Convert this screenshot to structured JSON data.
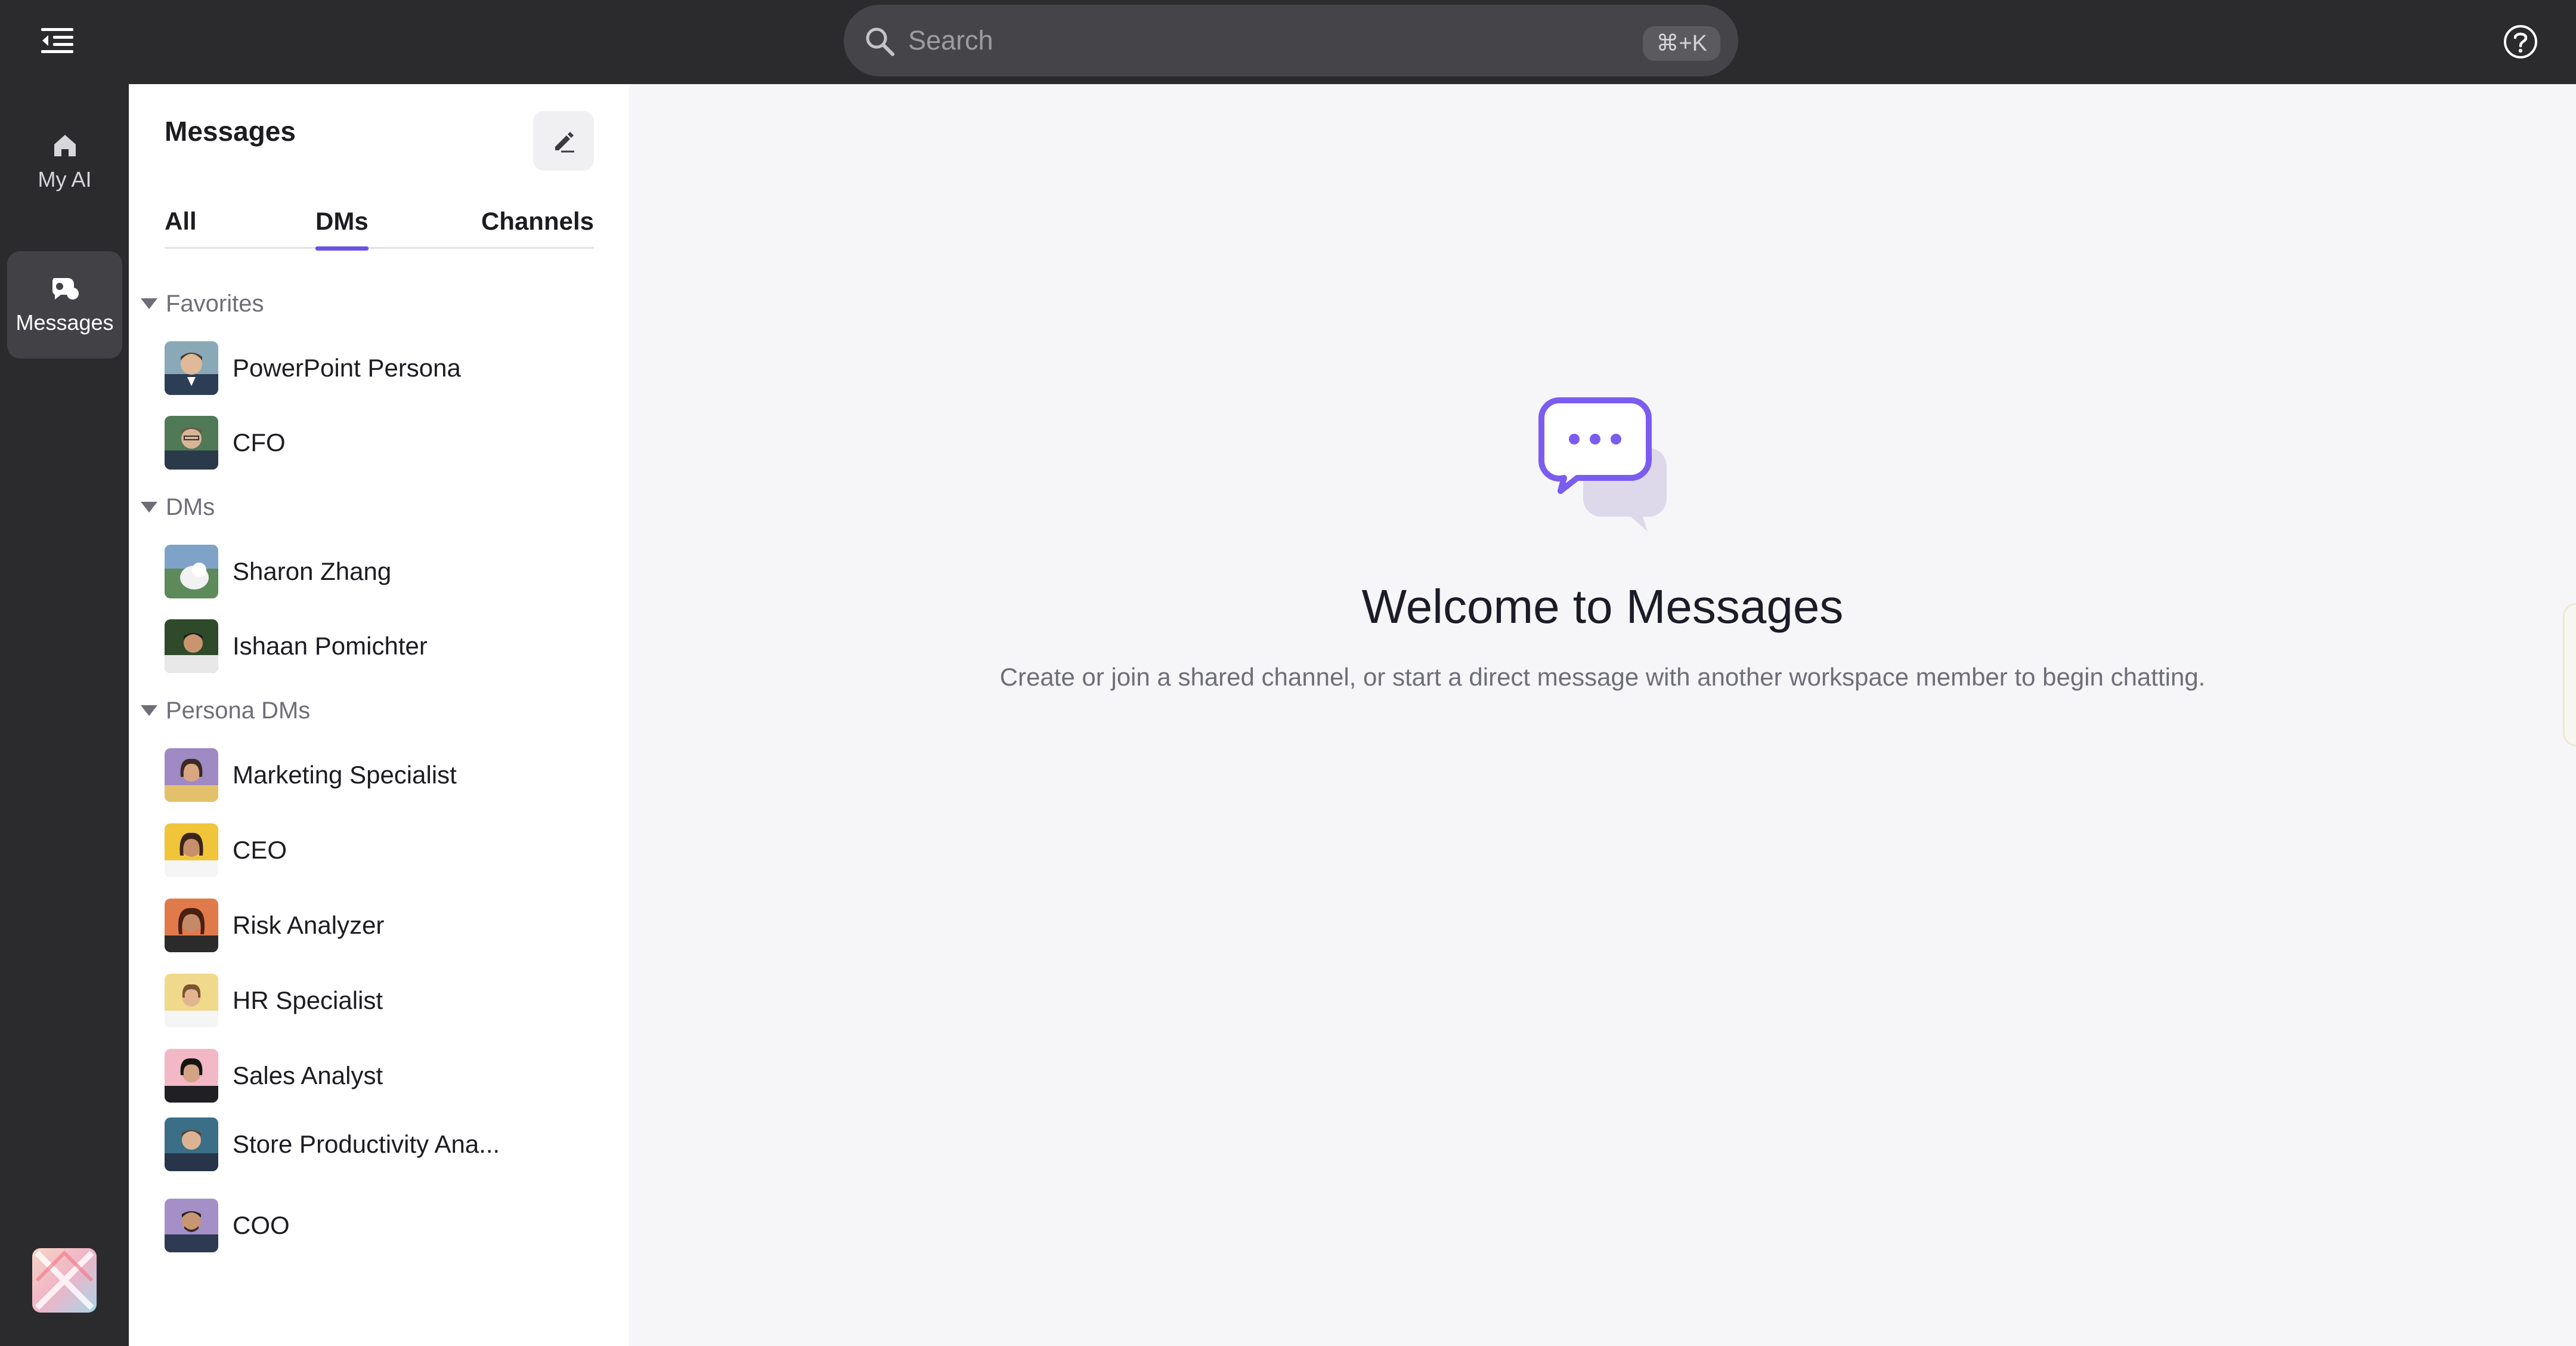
{
  "topbar": {
    "search_placeholder": "Search",
    "search_shortcut": "⌘+K"
  },
  "rail": {
    "items": [
      {
        "label": "My AI",
        "icon": "home-icon",
        "active": false
      },
      {
        "label": "Messages",
        "icon": "messages-icon",
        "active": true
      }
    ]
  },
  "panel": {
    "title": "Messages",
    "tabs": [
      {
        "label": "All",
        "active": false
      },
      {
        "label": "DMs",
        "active": true
      },
      {
        "label": "Channels",
        "active": false
      }
    ],
    "sections": [
      {
        "title": "Favorites",
        "contacts": [
          {
            "name": "PowerPoint Persona"
          },
          {
            "name": "CFO"
          }
        ]
      },
      {
        "title": "DMs",
        "contacts": [
          {
            "name": "Sharon Zhang"
          },
          {
            "name": "Ishaan Pomichter"
          }
        ]
      },
      {
        "title": "Persona DMs",
        "contacts": [
          {
            "name": "Marketing Specialist"
          },
          {
            "name": "CEO"
          },
          {
            "name": "Risk Analyzer"
          },
          {
            "name": "HR Specialist"
          },
          {
            "name": "Sales Analyst"
          },
          {
            "name": "Store Productivity Ana..."
          },
          {
            "name": "COO"
          }
        ]
      }
    ]
  },
  "main": {
    "welcome_title": "Welcome to Messages",
    "welcome_subtitle": "Create or join a shared channel, or start a direct message with another workspace member to begin chatting."
  },
  "colors": {
    "accent": "#6b52e6",
    "topbar_bg": "#2b2b2e",
    "main_bg": "#f6f6f8"
  }
}
